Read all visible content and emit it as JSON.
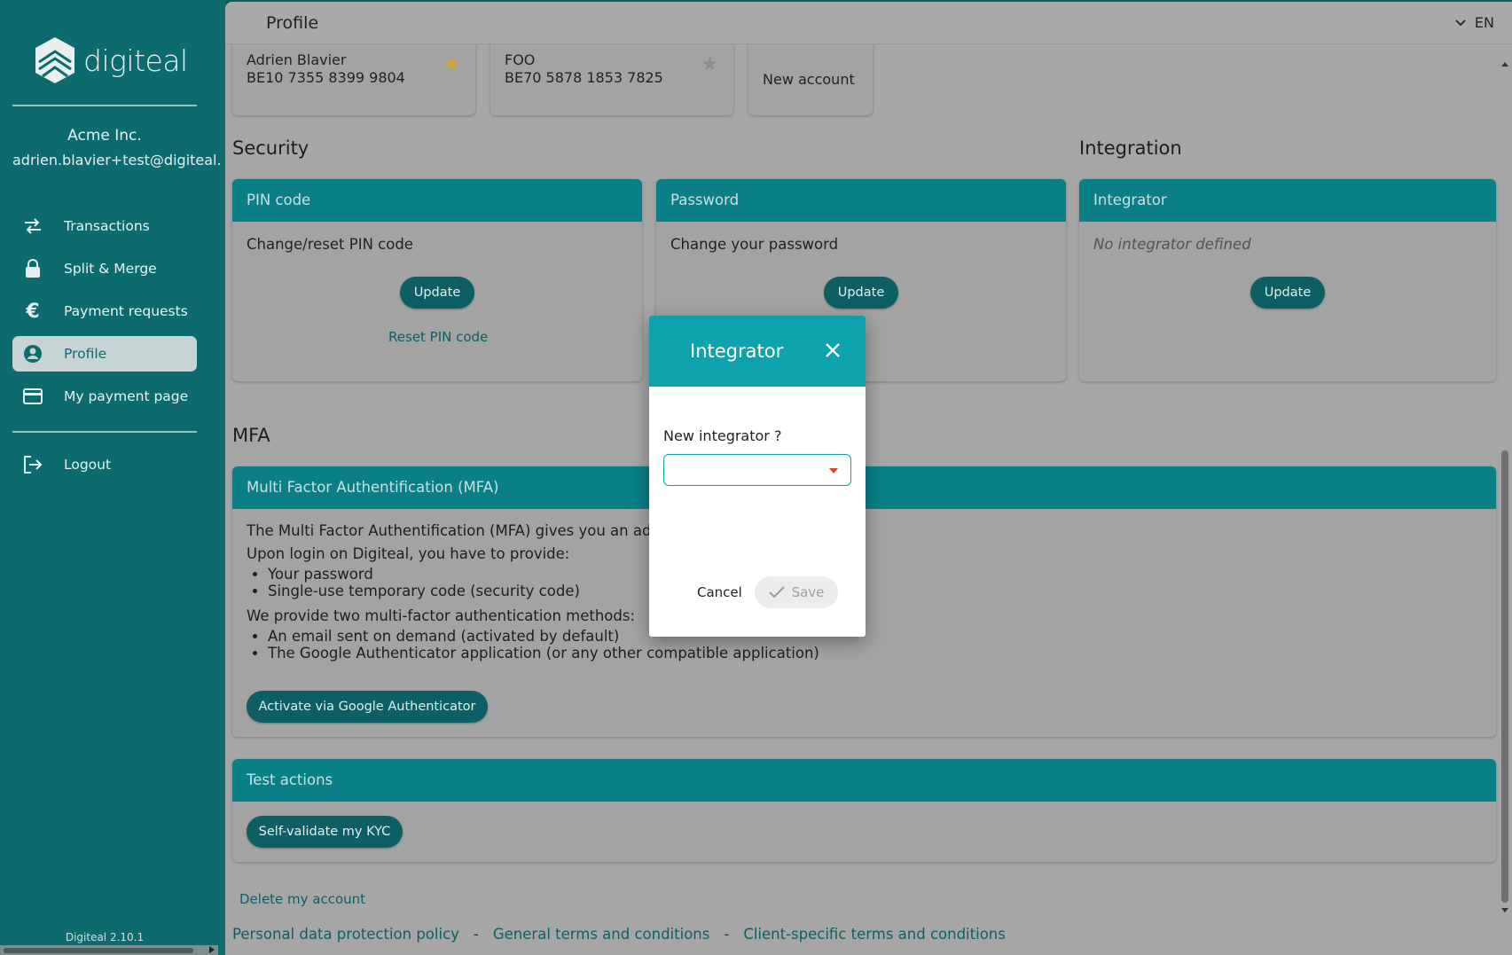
{
  "sidebar": {
    "logo_text": "digiteal",
    "company": "Acme Inc.",
    "email": "adrien.blavier+test@digiteal.e",
    "items": [
      {
        "label": "Transactions",
        "icon": "swap-arrows-icon"
      },
      {
        "label": "Split & Merge",
        "icon": "lock-icon"
      },
      {
        "label": "Payment requests",
        "icon": "euro-icon"
      },
      {
        "label": "Profile",
        "icon": "account-circle-icon",
        "active": true
      },
      {
        "label": "My payment page",
        "icon": "credit-card-icon"
      }
    ],
    "logout_label": "Logout",
    "version": "Digiteal 2.10.1"
  },
  "header": {
    "title": "Profile",
    "language": "EN"
  },
  "accounts": [
    {
      "name": "Adrien Blavier",
      "iban": "BE10 7355 8399 9804",
      "favorite": true
    },
    {
      "name": "FOO",
      "iban": "BE70 5878 1853 7825",
      "favorite": false
    }
  ],
  "new_account_label": "New account",
  "security": {
    "title": "Security",
    "pin": {
      "header": "PIN code",
      "text": "Change/reset PIN code",
      "update_label": "Update",
      "reset_label": "Reset PIN code"
    },
    "password": {
      "header": "Password",
      "text": "Change your password",
      "update_label": "Update"
    }
  },
  "integration": {
    "title": "Integration",
    "header": "Integrator",
    "empty_text": "No integrator defined",
    "update_label": "Update"
  },
  "mfa": {
    "title": "MFA",
    "header": "Multi Factor Authentification (MFA)",
    "intro": "The Multi Factor Authentification (MFA) gives you an add",
    "login_text": "Upon login on Digiteal, you have to provide:",
    "login_items": [
      "Your password",
      "Single-use temporary code (security code)"
    ],
    "methods_text": "We provide two multi-factor authentication methods:",
    "methods_items": [
      "An email sent on demand (activated by default)",
      "The Google Authenticator application (or any other compatible application)"
    ],
    "activate_label": "Activate via Google Authenticator"
  },
  "test_actions": {
    "header": "Test actions",
    "button_label": "Self-validate my KYC"
  },
  "delete_account_label": "Delete my account",
  "footer": {
    "links": [
      "Personal data protection policy",
      "General terms and conditions",
      "Client-specific terms and conditions"
    ],
    "separator": "-"
  },
  "modal": {
    "title": "Integrator",
    "field_label": "New integrator ?",
    "select_value": "",
    "cancel_label": "Cancel",
    "save_label": "Save"
  },
  "colors": {
    "sidebar_bg": "#0d6b6e",
    "card_header": "#0a7f86",
    "modal_header": "#0ea2ac",
    "button": "#0d5f63",
    "star_active": "#d4a62a"
  }
}
